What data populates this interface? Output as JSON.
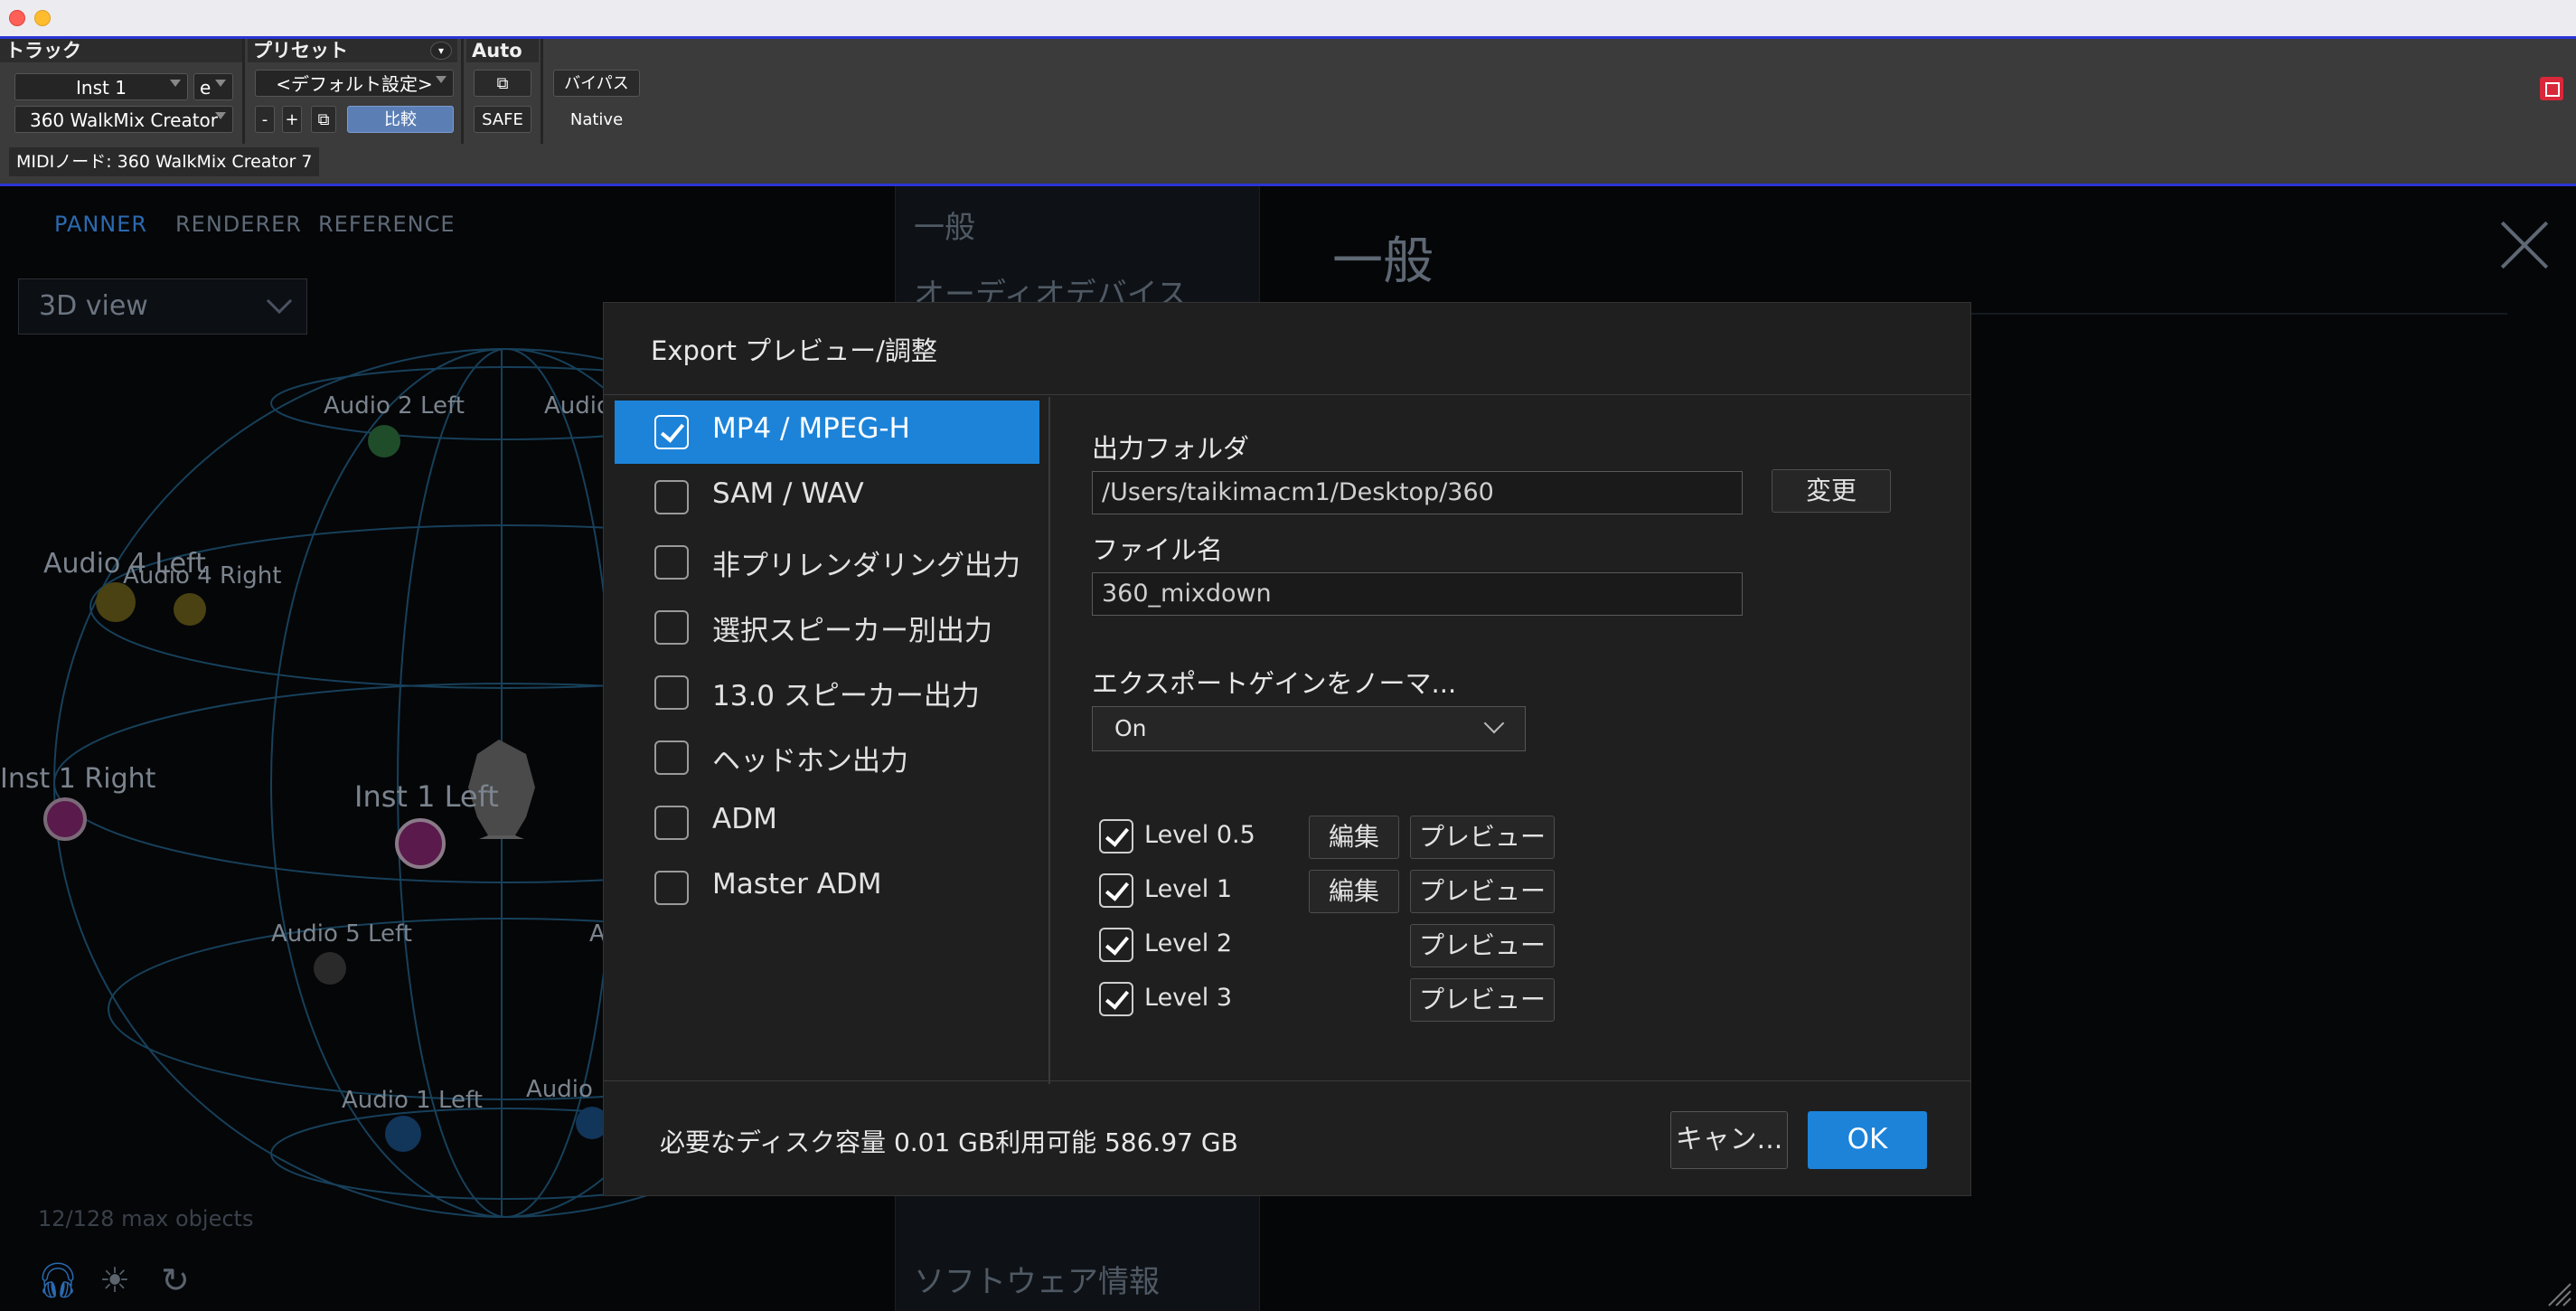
{
  "plugin_header": {
    "track_label": "トラック",
    "preset_label": "プリセット",
    "auto_label": "Auto",
    "track_name": "Inst 1",
    "track_suffix": "e",
    "plugin_name": "360 WalkMix Creator",
    "preset_value": "<デフォルト設定>",
    "minus": "-",
    "plus": "+",
    "compare": "比較",
    "safe": "SAFE",
    "bypass": "バイパス",
    "native": "Native",
    "midi_node": "MIDIノード: 360 WalkMix Creator 7"
  },
  "background": {
    "tabs": [
      "PANNER",
      "RENDERER",
      "REFERENCE"
    ],
    "view_select": "3D view",
    "objects": [
      {
        "label": "Audio 2 Left"
      },
      {
        "label": "Audio"
      },
      {
        "label": "Audio 4 Left"
      },
      {
        "label": "Audio 4 Right"
      },
      {
        "label": "Inst 1 Right"
      },
      {
        "label": "Inst 1 Left"
      },
      {
        "label": "Audio 5 Left"
      },
      {
        "label": "A"
      },
      {
        "label": "Audio 1 Left"
      },
      {
        "label": "Audio 1"
      }
    ],
    "max_objects": "12/128 max objects",
    "settings_nav": [
      "一般",
      "オーディオデバイス",
      "ソフトウェア情報"
    ],
    "settings_header": "一般"
  },
  "modal": {
    "title": "Export プレビュー/調整",
    "formats": [
      {
        "label": "MP4 / MPEG-H",
        "checked": true,
        "selected": true
      },
      {
        "label": "SAM / WAV",
        "checked": false,
        "selected": false
      },
      {
        "label": "非プリレンダリング出力",
        "checked": false,
        "selected": false
      },
      {
        "label": "選択スピーカー別出力",
        "checked": false,
        "selected": false
      },
      {
        "label": "13.0 スピーカー出力",
        "checked": false,
        "selected": false
      },
      {
        "label": "ヘッドホン出力",
        "checked": false,
        "selected": false
      },
      {
        "label": "ADM",
        "checked": false,
        "selected": false
      },
      {
        "label": "Master ADM",
        "checked": false,
        "selected": false
      }
    ],
    "output_folder_label": "出力フォルダ",
    "output_folder_value": "/Users/taikimacm1/Desktop/360",
    "change_button": "変更",
    "file_name_label": "ファイル名",
    "file_name_value": "360_mixdown",
    "normalize_label": "エクスポートゲインをノーマ...",
    "normalize_value": "On",
    "levels": [
      {
        "label": "Level 0.5",
        "checked": true,
        "edit": "編集",
        "preview": "プレビュー"
      },
      {
        "label": "Level 1",
        "checked": true,
        "edit": "編集",
        "preview": "プレビュー"
      },
      {
        "label": "Level 2",
        "checked": true,
        "edit": "",
        "preview": "プレビュー"
      },
      {
        "label": "Level 3",
        "checked": true,
        "edit": "",
        "preview": "プレビュー"
      }
    ],
    "disk_info": "必要なディスク容量 0.01 GB利用可能 586.97 GB",
    "cancel": "キャン...",
    "ok": "OK"
  }
}
